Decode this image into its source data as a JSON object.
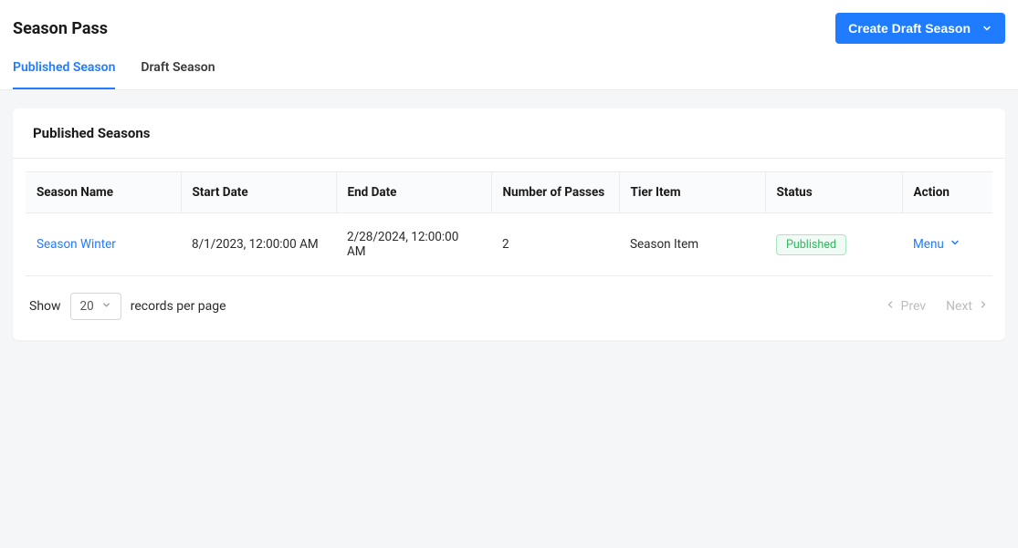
{
  "header": {
    "title": "Season Pass",
    "create_button_label": "Create Draft Season"
  },
  "tabs": [
    {
      "label": "Published Season",
      "active": true
    },
    {
      "label": "Draft Season",
      "active": false
    }
  ],
  "card": {
    "title": "Published Seasons"
  },
  "table": {
    "columns": [
      "Season Name",
      "Start Date",
      "End Date",
      "Number of Passes",
      "Tier Item",
      "Status",
      "Action"
    ],
    "rows": [
      {
        "season_name": "Season Winter",
        "start_date": "8/1/2023, 12:00:00 AM",
        "end_date": "2/28/2024, 12:00:00 AM",
        "number_of_passes": "2",
        "tier_item": "Season Item",
        "status": "Published",
        "action_label": "Menu"
      }
    ]
  },
  "pagination": {
    "show_label": "Show",
    "page_size": "20",
    "records_label": "records per page",
    "prev_label": "Prev",
    "next_label": "Next"
  }
}
